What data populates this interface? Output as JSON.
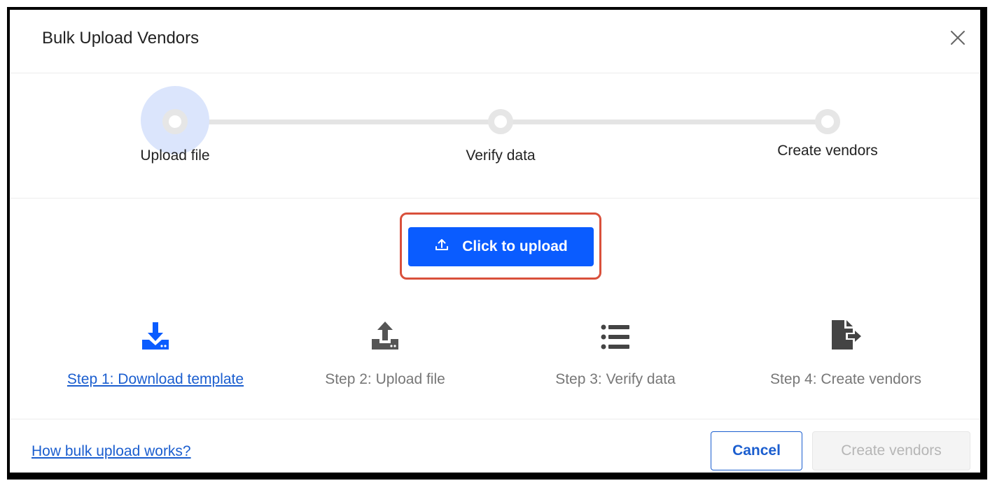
{
  "dialog": {
    "title": "Bulk Upload Vendors",
    "close_icon": "close-icon"
  },
  "stepper": {
    "active_index": 0,
    "steps": [
      {
        "label": "Upload file"
      },
      {
        "label": "Verify data"
      },
      {
        "label": "Create vendors"
      }
    ]
  },
  "upload": {
    "button_label": "Click to upload",
    "icon": "upload-icon"
  },
  "how_it_works": [
    {
      "label": "Step 1: Download template",
      "icon": "download-tray-icon",
      "is_link": true
    },
    {
      "label": "Step 2: Upload file",
      "icon": "upload-tray-icon",
      "is_link": false
    },
    {
      "label": "Step 3: Verify data",
      "icon": "list-icon",
      "is_link": false
    },
    {
      "label": "Step 4: Create vendors",
      "icon": "file-export-icon",
      "is_link": false
    }
  ],
  "footer": {
    "help_link": "How bulk upload works?",
    "cancel_label": "Cancel",
    "create_label": "Create vendors"
  },
  "colors": {
    "primary": "#0a5cff",
    "link": "#1b5ecf",
    "highlight_border": "#d9503b",
    "active_halo": "#dbe5fc",
    "disabled_text": "#b6b6b6"
  }
}
